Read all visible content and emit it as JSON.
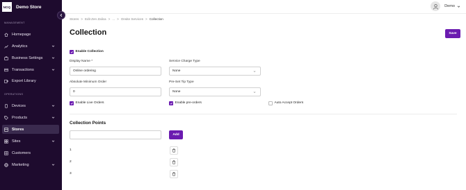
{
  "app": {
    "logo_text": "NOQ",
    "store_name": "Demo Store"
  },
  "sidebar": {
    "section_management": "MANAGEMENT",
    "section_operations": "OPERATIONS",
    "items": [
      {
        "label": "Homepage",
        "icon": "home-icon"
      },
      {
        "label": "Analytics",
        "icon": "chart-icon"
      },
      {
        "label": "Business Settings",
        "icon": "briefcase-icon"
      },
      {
        "label": "Transactions",
        "icon": "card-icon"
      },
      {
        "label": "Export Library",
        "icon": "export-icon"
      },
      {
        "label": "Devices",
        "icon": "device-icon"
      },
      {
        "label": "Products",
        "icon": "tag-icon"
      },
      {
        "label": "Stores",
        "icon": "store-icon",
        "active": true
      },
      {
        "label": "Sites",
        "icon": "grid-icon"
      },
      {
        "label": "Customers",
        "icon": "users-icon"
      },
      {
        "label": "Marketing",
        "icon": "globe-icon"
      }
    ]
  },
  "user": {
    "name": "Demo"
  },
  "breadcrumb": [
    "Stores",
    "Edit Zen Zalica",
    "...",
    "Onsite Services",
    "Collection"
  ],
  "page": {
    "title": "Collection",
    "save_label": "Save"
  },
  "form": {
    "enable_collection": {
      "label": "Enable Collection",
      "checked": true
    },
    "display_name": {
      "label": "Display Name *",
      "value": "Online ordering"
    },
    "service_charge_type": {
      "label": "Service Charge Type",
      "value": "None"
    },
    "absolute_minimum_order": {
      "label": "Absolute Minimum Order",
      "value": "0"
    },
    "pre_set_tip_type": {
      "label": "Pre-Set Tip Type",
      "value": "None"
    },
    "enable_live_orders": {
      "label": "Enable Live Orders",
      "checked": true
    },
    "enable_pre_orders": {
      "label": "Enable pre-orders",
      "checked": true
    },
    "auto_accept_orders": {
      "label": "Auto Accept Orders",
      "checked": false
    }
  },
  "collection_points": {
    "title": "Collection Points",
    "new_point_value": "",
    "add_label": "Add",
    "points": [
      "1",
      "2",
      "3"
    ]
  },
  "colors": {
    "sidebar_bg": "#1e0b2e",
    "accent": "#6b1bb0"
  }
}
